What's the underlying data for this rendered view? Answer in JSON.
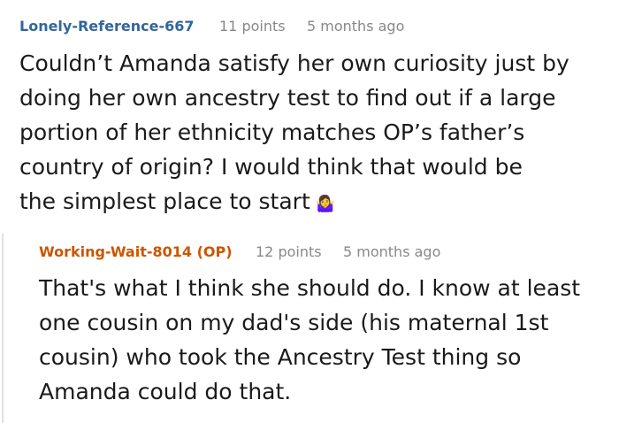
{
  "comment": {
    "author": "Lonely-Reference-667",
    "points": "11 points",
    "time": "5 months ago",
    "lines": [
      "Couldn’t Amanda satisfy her own curiosity just by",
      "doing her own ancestry test to find out if a large",
      "portion of her ethnicity matches OP’s father’s",
      "country of origin? I would think that would be",
      "the simplest place to start"
    ],
    "emoji": "🤷‍♀️"
  },
  "reply": {
    "author": "Working-Wait-8014 (OP)",
    "points": "12 points",
    "time": "5 months ago",
    "lines": [
      "That's what I think she should do. I know at least",
      "one cousin on my dad's side (his maternal 1st",
      "cousin) who took the Ancestry Test thing so",
      "Amanda could do that."
    ]
  },
  "colors": {
    "op_author": "#336699",
    "reply_author": "#cc5500",
    "meta_gray": "#888888",
    "text": "#1a1a1b"
  }
}
